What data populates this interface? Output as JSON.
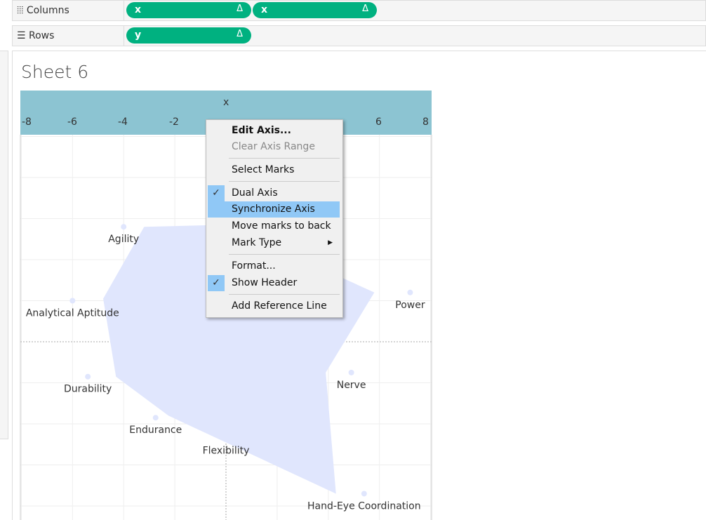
{
  "shelves": {
    "columns_label": "Columns",
    "rows_label": "Rows",
    "columns_pills": [
      {
        "label": "x",
        "delta": "Δ"
      },
      {
        "label": "x",
        "delta": "Δ"
      }
    ],
    "rows_pills": [
      {
        "label": "y",
        "delta": "Δ"
      }
    ]
  },
  "sheet": {
    "title": "Sheet 6",
    "axis_title": "x",
    "ticks": [
      "-8",
      "-6",
      "-4",
      "-2",
      "6",
      "8"
    ]
  },
  "context_menu": {
    "items": [
      {
        "label": "Edit Axis...",
        "bold": true
      },
      {
        "label": "Clear Axis Range",
        "disabled": true
      },
      {
        "label": "Select Marks"
      },
      {
        "label": "Dual Axis",
        "checked": true
      },
      {
        "label": "Synchronize Axis",
        "highlighted": true
      },
      {
        "label": "Move marks to back"
      },
      {
        "label": "Mark Type",
        "submenu": true
      },
      {
        "label": "Format..."
      },
      {
        "label": "Show Header",
        "checked": true
      },
      {
        "label": "Add Reference Line"
      }
    ]
  },
  "chart_data": {
    "type": "scatter",
    "xlim": [
      -8,
      8
    ],
    "x_axis_label": "x",
    "fill_color": "#e0e6fd",
    "point_color": "#e0e6fd",
    "points": [
      {
        "label": "Agility",
        "x": -4,
        "y": 2.8
      },
      {
        "label": "Analytical Aptitude",
        "x": -6,
        "y": 1.0
      },
      {
        "label": "Power",
        "x": 7.2,
        "y": 1.2
      },
      {
        "label": "Durability",
        "x": -5.4,
        "y": -0.85
      },
      {
        "label": "Nerve",
        "x": 4.9,
        "y": -0.75
      },
      {
        "label": "Endurance",
        "x": -2.75,
        "y": -1.85
      },
      {
        "label": "Flexibility",
        "x": 0,
        "y": -2.35
      },
      {
        "label": "Hand-Eye Coordination",
        "x": 5.4,
        "y": -3.7
      }
    ],
    "polygon": [
      [
        -3.2,
        2.8
      ],
      [
        0,
        2.85
      ],
      [
        5.8,
        1.2
      ],
      [
        3.9,
        -0.75
      ],
      [
        4.3,
        -3.7
      ],
      [
        -2.25,
        -1.8
      ],
      [
        -4.3,
        -0.85
      ],
      [
        -4.8,
        1.05
      ]
    ]
  }
}
